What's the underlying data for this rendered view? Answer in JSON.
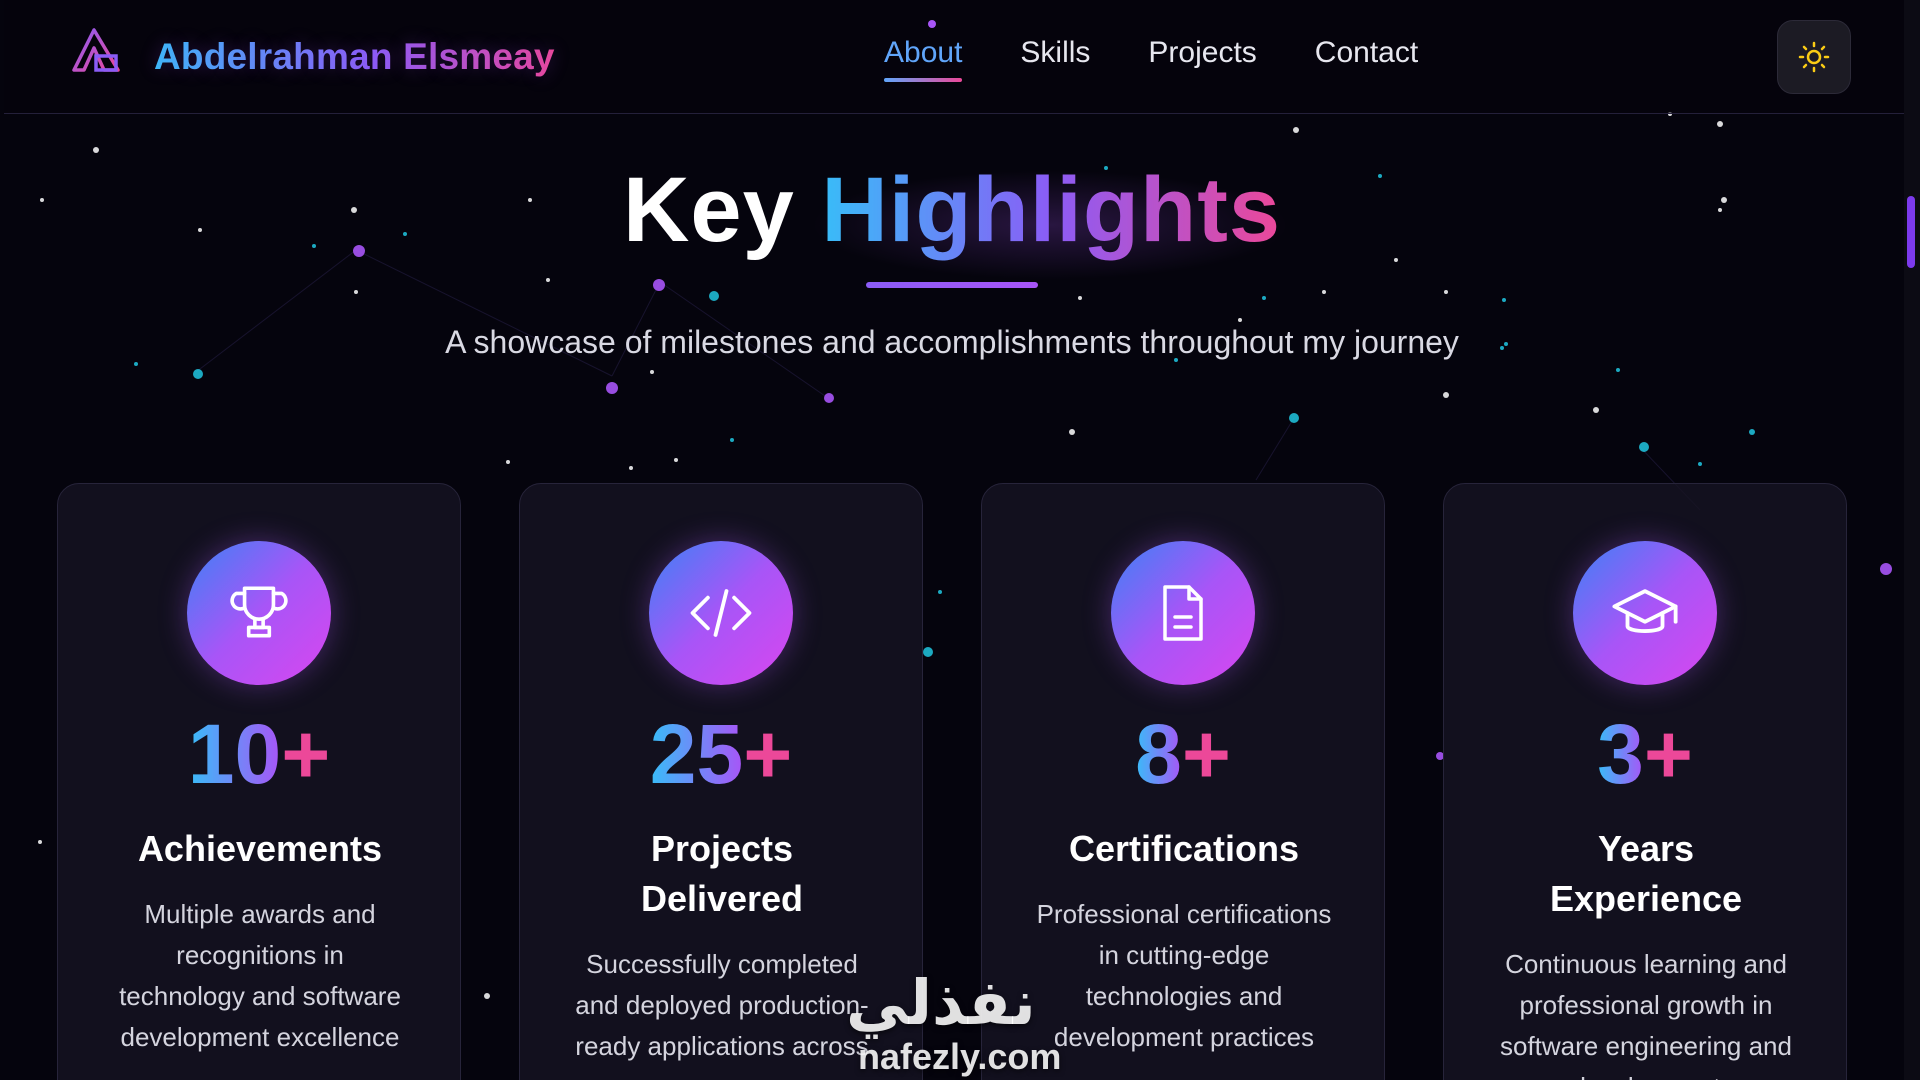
{
  "nav": {
    "brand": "Abdelrahman Elsmeay",
    "links": [
      {
        "label": "About",
        "active": true
      },
      {
        "label": "Skills",
        "active": false
      },
      {
        "label": "Projects",
        "active": false
      },
      {
        "label": "Contact",
        "active": false
      }
    ],
    "theme_toggle_icon": "sun-icon",
    "logo_icon": "triangle-logo-icon"
  },
  "header": {
    "title_main": "Key",
    "title_accent": "Highlights",
    "subtitle": "A showcase of milestones and accomplishments throughout my journey"
  },
  "cards": [
    {
      "icon": "trophy-icon",
      "number": "10",
      "suffix": "+",
      "title": "Achievements",
      "description": "Multiple awards and recognitions in technology and software development excellence"
    },
    {
      "icon": "code-icon",
      "number": "25",
      "suffix": "+",
      "title": "Projects Delivered",
      "description": "Successfully completed and deployed production-ready applications across"
    },
    {
      "icon": "document-icon",
      "number": "8",
      "suffix": "+",
      "title": "Certifications",
      "description": "Professional certifications in cutting-edge technologies and development practices"
    },
    {
      "icon": "graduation-cap-icon",
      "number": "3",
      "suffix": "+",
      "title": "Years Experience",
      "description": "Continuous learning and professional growth in software engineering and development"
    }
  ],
  "watermark": {
    "arabic": "نفذلي",
    "latin": "nafezly.com"
  },
  "colors": {
    "background": "#05040d",
    "accent_blue": "#38bdf8",
    "accent_purple": "#a855f7",
    "accent_pink": "#ec4899",
    "card_bg": "#161422"
  }
}
